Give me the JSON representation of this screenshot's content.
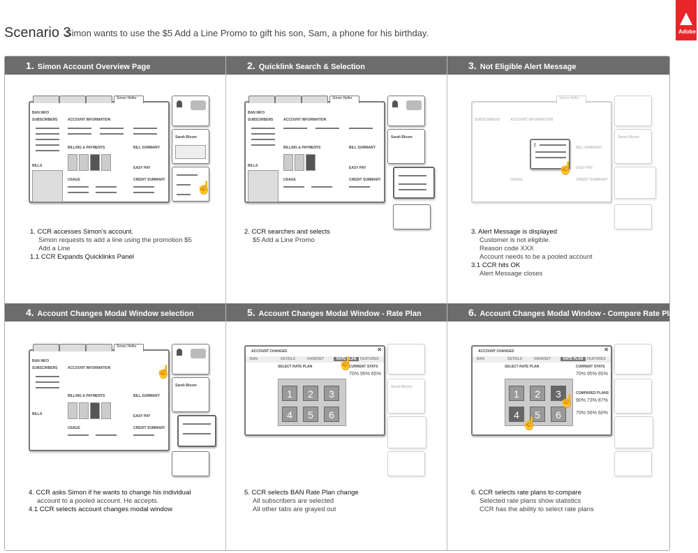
{
  "header": {
    "scenario": "Scenario 3",
    "subtitle": "Simon wants to use the $5 Add a Line Promo to gift his son, Sam, a phone for his birthday.",
    "brand": "Adobe"
  },
  "panels": [
    {
      "number": "1.",
      "title": "Simon  Account Overview Page",
      "lines": [
        "1. CCR accesses Simon's account.",
        "Simon requests to add a line using the promotion $5 Add a Line",
        "1.1 CCR Expands Quicklinks Panel"
      ]
    },
    {
      "number": "2.",
      "title": "Quicklink Search & Selection",
      "lines": [
        "2. CCR searches and selects",
        "$5 Add a Line Promo"
      ]
    },
    {
      "number": "3.",
      "title": "Not Eligible Alert Message",
      "lines": [
        "3. Alert Message is displayed",
        "Customer is not eligible.",
        "Reason code XXX",
        "Account needs to be a pooled account",
        "3.1 CCR hits OK",
        "Alert Message closes"
      ]
    },
    {
      "number": "4.",
      "title": "Account Changes Modal Window selection",
      "lines": [
        "4. CCR asks Simon if he wants to change his individual",
        "account to a pooled account.  He accepts.",
        "4.1 CCR selects account changes modal window"
      ]
    },
    {
      "number": "5.",
      "title": "Account Changes Modal Window - Rate Plan",
      "lines": [
        "5. CCR selects BAN Rate Plan change",
        "All subscribers are selected",
        "All other tabs are grayed out"
      ]
    },
    {
      "number": "6.",
      "title": "Account Changes Modal Window - Compare Rate Plans",
      "lines": [
        "6. CCR selects rate plans to compare",
        "Selected rate plans show statistics",
        "CCR has the ability to select rate plans"
      ]
    }
  ],
  "wireframe": {
    "user": "Simon Heller",
    "contact": "Sarah Bloom",
    "ban_info": "BAN INFO",
    "subscribers": "SUBSCRIBERS",
    "bills": "BILLS",
    "account_info": "ACCOUNT INFORMATION",
    "billing": "BILLING & PAYMENTS",
    "bill_summary": "BILL SUMMARY",
    "easy_pay": "EASY PAY",
    "usage": "USAGE",
    "credit_summary": "CREDIT SUMMARY",
    "modal_title": "ACCOUNT CHANGES",
    "modal_tabs": [
      "BAN",
      "DETAILS",
      "HANDSET",
      "RATE PLAN",
      "FEATURES"
    ],
    "select_rate_plan": "SELECT RATE PLAN",
    "current_stats": "CURRENT STATS",
    "stats": "70%   95%   65%",
    "compared_plans": "COMPARED PLANS",
    "compared_1": "90%   73%   87%",
    "compared_2": "70%   56%   60%",
    "grid": [
      "1",
      "2",
      "3",
      "4",
      "5",
      "6"
    ],
    "alert_mark": "!"
  }
}
